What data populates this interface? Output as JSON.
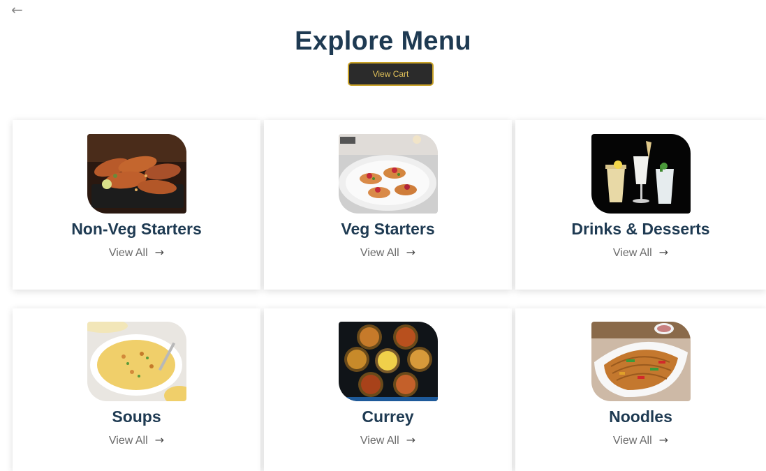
{
  "header": {
    "back_icon": "arrow-left-icon",
    "title": "Explore Menu",
    "cart_button": "View Cart"
  },
  "categories": [
    {
      "name": "Non-Veg Starters",
      "link": "View All",
      "image": "grilled-chicken-image"
    },
    {
      "name": "Veg Starters",
      "link": "View All",
      "image": "bruschetta-plate-image"
    },
    {
      "name": "Drinks & Desserts",
      "link": "View All",
      "image": "drinks-glasses-image"
    },
    {
      "name": "Soups",
      "link": "View All",
      "image": "soup-bowl-image"
    },
    {
      "name": "Currey",
      "link": "View All",
      "image": "curry-bowls-image"
    },
    {
      "name": "Noodles",
      "link": "View All",
      "image": "noodles-bowl-image"
    }
  ],
  "colors": {
    "title": "#1e3a52",
    "cart_bg": "#2b2b2b",
    "cart_border": "#c9a227",
    "cart_text": "#e2c25a",
    "link_text": "#6a6a6a"
  }
}
